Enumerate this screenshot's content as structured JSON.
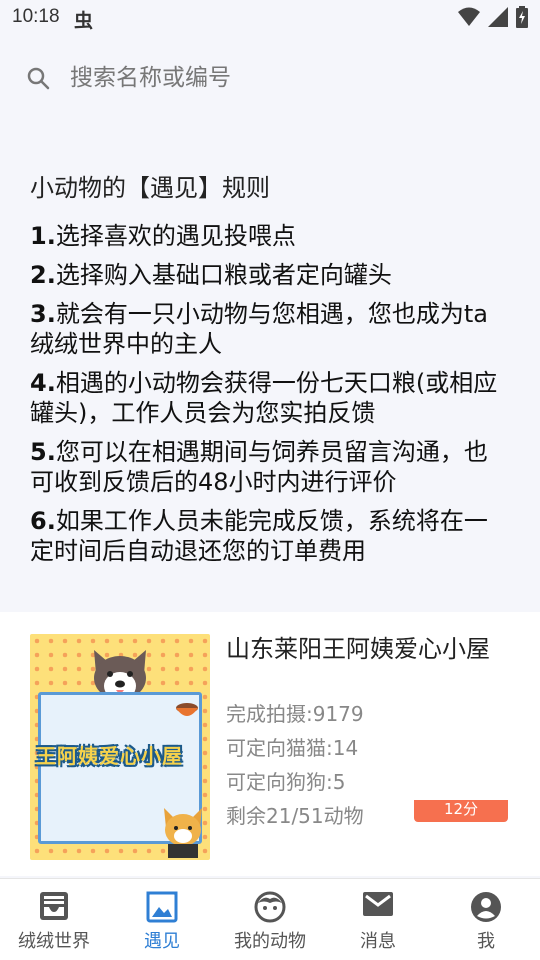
{
  "status_bar": {
    "time": "10:18",
    "app_glyph": "虫"
  },
  "search": {
    "placeholder": "搜索名称或编号"
  },
  "rules": {
    "title": "小动物的【遇见】规则",
    "items": [
      {
        "num": "1.",
        "text": "选择喜欢的遇见投喂点"
      },
      {
        "num": "2.",
        "text": "选择购入基础口粮或者定向罐头"
      },
      {
        "num": "3.",
        "text": "就会有一只小动物与您相遇，您也成为ta绒绒世界中的主人"
      },
      {
        "num": "4.",
        "text": "相遇的小动物会获得一份七天口粮(或相应罐头)，工作人员会为您实拍反馈"
      },
      {
        "num": "5.",
        "text": "您可以在相遇期间与饲养员留言沟通，也可收到反馈后的48小时内进行评价"
      },
      {
        "num": "6.",
        "text": "如果工作人员未能完成反馈，系统将在一定时间后自动退还您的订单费用"
      }
    ]
  },
  "card": {
    "image_title": "王阿姨爱心小屋",
    "title": "山东莱阳王阿姨爱心小屋",
    "stats": [
      "完成拍摄:9179",
      "可定向猫猫:14",
      "可定向狗狗:5",
      "剩余21/51动物"
    ],
    "score": "12分"
  },
  "nav": {
    "items": [
      {
        "label": "绒绒世界",
        "icon": "inbox-icon",
        "active": false
      },
      {
        "label": "遇见",
        "icon": "photo-icon",
        "active": true
      },
      {
        "label": "我的动物",
        "icon": "pet-face-icon",
        "active": false
      },
      {
        "label": "消息",
        "icon": "mail-icon",
        "active": false
      },
      {
        "label": "我",
        "icon": "account-icon",
        "active": false
      }
    ]
  },
  "colors": {
    "accent": "#2f7fd4",
    "badge": "#f6704f",
    "nav_inactive": "#555555"
  }
}
